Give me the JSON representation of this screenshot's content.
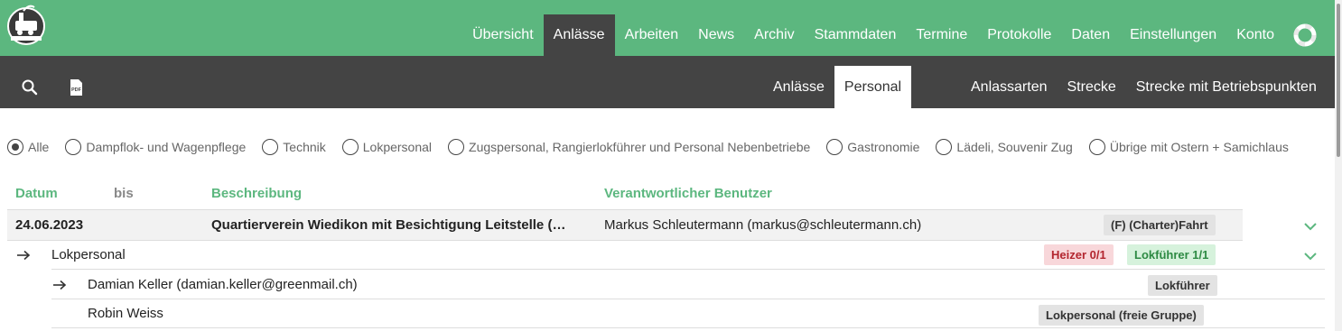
{
  "logo": {
    "icon": "steam-locomotive-logo-icon",
    "colors": {
      "bg": "#3a3a3a",
      "ring": "#ffffff"
    }
  },
  "topnav": {
    "items": [
      {
        "label": "Übersicht"
      },
      {
        "label": "Anlässe",
        "active": true
      },
      {
        "label": "Arbeiten"
      },
      {
        "label": "News"
      },
      {
        "label": "Archiv"
      },
      {
        "label": "Stammdaten"
      },
      {
        "label": "Termine"
      },
      {
        "label": "Protokolle"
      },
      {
        "label": "Daten"
      },
      {
        "label": "Einstellungen"
      },
      {
        "label": "Konto"
      }
    ],
    "help_icon": "lifebuoy-icon"
  },
  "subnav": {
    "left_icons": [
      "search-icon",
      "pdf-icon"
    ],
    "items": [
      {
        "label": "Anlässe"
      },
      {
        "label": "Personal",
        "active": true
      },
      {
        "label": "Anlassarten"
      },
      {
        "label": "Strecke"
      },
      {
        "label": "Strecke mit Betriebspunkten"
      }
    ]
  },
  "filters": [
    {
      "label": "Alle",
      "checked": true
    },
    {
      "label": "Dampflok- und Wagenpflege"
    },
    {
      "label": "Technik"
    },
    {
      "label": "Lokpersonal"
    },
    {
      "label": "Zugspersonal, Rangierlokführer und Personal Nebenbetriebe"
    },
    {
      "label": "Gastronomie"
    },
    {
      "label": "Lädeli, Souvenir Zug"
    },
    {
      "label": "Übrige mit Ostern + Samichlaus"
    }
  ],
  "table": {
    "headers": {
      "datum": "Datum",
      "bis": "bis",
      "beschreibung": "Beschreibung",
      "verantwortlicher": "Verantwortlicher Benutzer"
    },
    "event": {
      "datum": "24.06.2023",
      "beschreibung": "Quartierverein Wiedikon mit Besichtigung Leitstelle (…",
      "verantwortlicher": "Markus Schleutermann (markus@schleutermann.ch)",
      "type_badge": "(F) (Charter)Fahrt"
    },
    "group": {
      "label": "Lokpersonal",
      "badges": [
        {
          "label": "Heizer 0/1",
          "status": "missing"
        },
        {
          "label": "Lokführer 1/1",
          "status": "complete"
        }
      ]
    },
    "persons": [
      {
        "name": "Damian Keller (damian.keller@greenmail.ch)",
        "role": "Lokführer",
        "arrow": true
      },
      {
        "name": "Robin Weiss",
        "role": "Lokpersonal (freie Gruppe)",
        "arrow": false
      }
    ]
  },
  "colors": {
    "accent": "#5cb77f",
    "dark": "#444444",
    "danger": "#b3262f",
    "success": "#2d8a43"
  }
}
